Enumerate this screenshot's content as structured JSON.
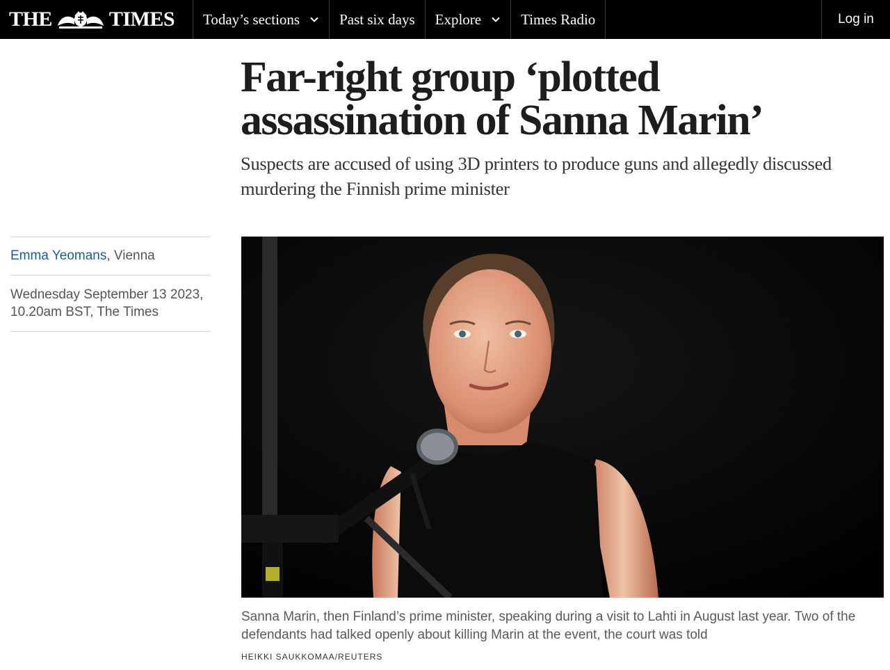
{
  "header": {
    "logo_left": "THE",
    "logo_right": "TIMES",
    "nav": [
      {
        "label": "Today’s sections",
        "has_dropdown": true,
        "icon": "chevron-down-icon"
      },
      {
        "label": "Past six days",
        "has_dropdown": false
      },
      {
        "label": "Explore",
        "has_dropdown": true,
        "icon": "chevron-down-icon"
      },
      {
        "label": "Times Radio",
        "has_dropdown": false
      }
    ],
    "login_label": "Log in"
  },
  "article": {
    "headline": "Far-right group ‘plotted assassination of Sanna Marin’",
    "standfirst": "Suspects are accused of using 3D printers to produce guns and allegedly discussed murdering the Finnish prime minister",
    "author": "Emma Yeomans",
    "location": ", Vienna",
    "date": "Wednesday September 13 2023, 10.20am BST, The Times",
    "image_caption": "Sanna Marin, then Finland’s prime minister, speaking during a visit to Lahti in August last year. Two of the defendants had talked openly about killing Marin at the event, the court was told",
    "image_credit": "HEIKKI SAUKKOMAA/REUTERS"
  },
  "colors": {
    "header_bg": "#000000",
    "author_link": "#1a5f8f",
    "headline": "#1d1d1b"
  }
}
